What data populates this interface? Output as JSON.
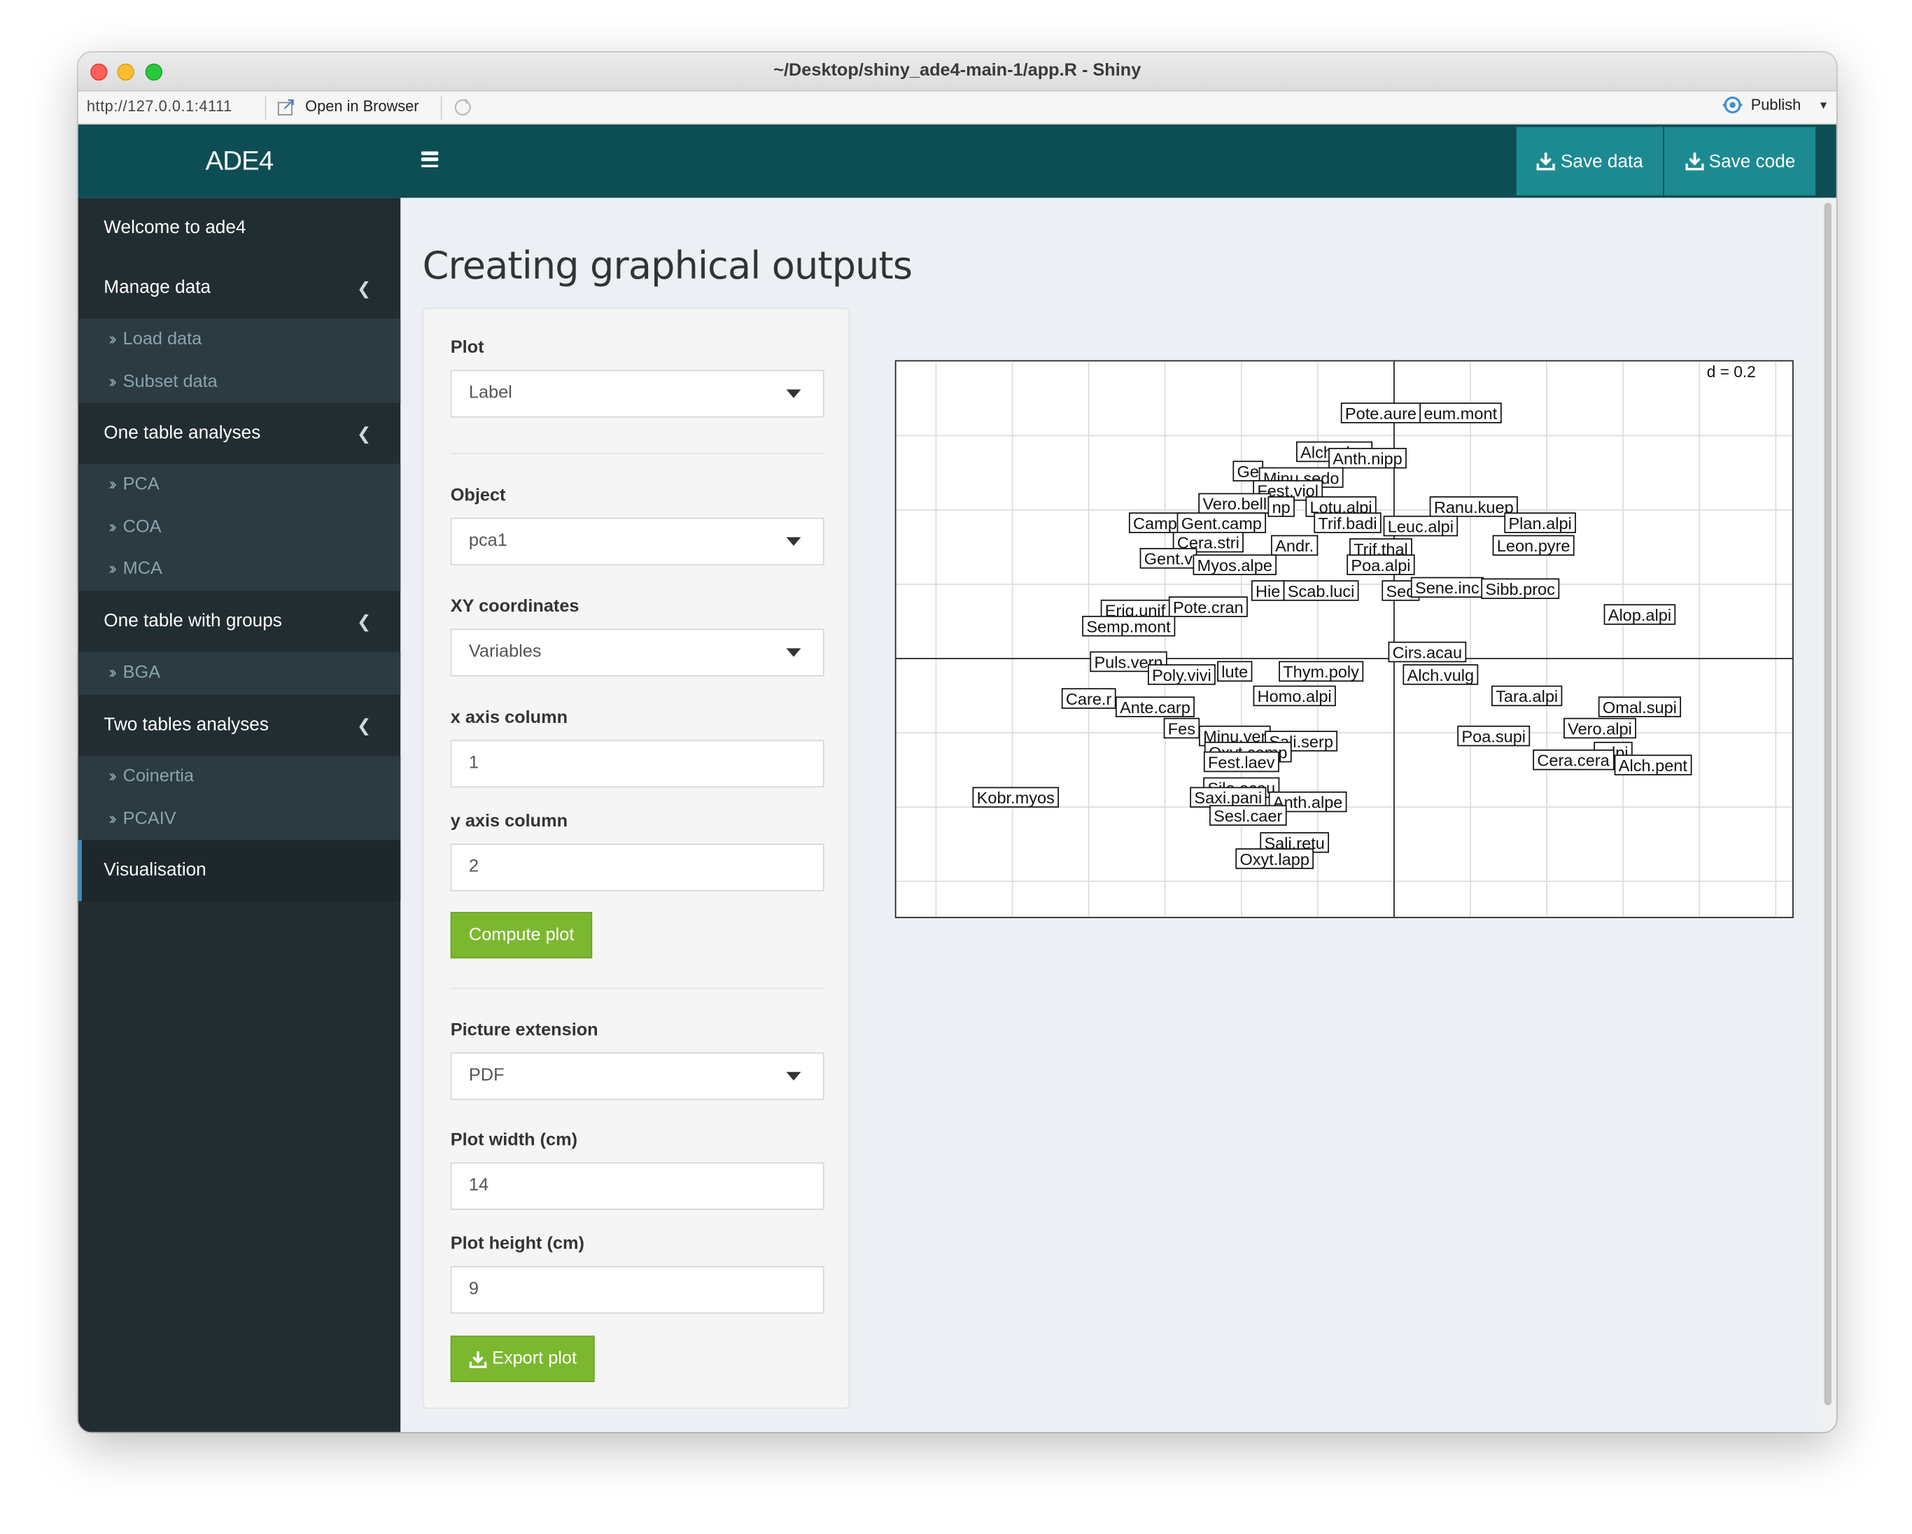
{
  "window": {
    "title": "~/Desktop/shiny_ade4-main-1/app.R - Shiny"
  },
  "addressbar": {
    "url": "http://127.0.0.1:4111",
    "open_in_browser": "Open in Browser",
    "publish": "Publish"
  },
  "navbar": {
    "logo": "ADE4",
    "save_data": "Save data",
    "save_code": "Save code"
  },
  "sidebar": {
    "welcome": "Welcome to ade4",
    "manage_data": "Manage data",
    "load_data": "Load data",
    "subset_data": "Subset data",
    "one_table": "One table analyses",
    "pca": "PCA",
    "coa": "COA",
    "mca": "MCA",
    "one_table_groups": "One table with groups",
    "bga": "BGA",
    "two_tables": "Two tables analyses",
    "coinertia": "Coinertia",
    "pcaiv": "PCAIV",
    "visualisation": "Visualisation"
  },
  "main": {
    "title": "Creating graphical outputs"
  },
  "form": {
    "plot_label": "Plot",
    "plot_value": "Label",
    "object_label": "Object",
    "object_value": "pca1",
    "xy_label": "XY coordinates",
    "xy_value": "Variables",
    "xaxis_label": "x axis column",
    "xaxis_value": "1",
    "yaxis_label": "y axis column",
    "yaxis_value": "2",
    "compute_button": "Compute plot",
    "ext_label": "Picture extension",
    "ext_value": "PDF",
    "width_label": "Plot width (cm)",
    "width_value": "14",
    "height_label": "Plot height (cm)",
    "height_value": "9",
    "export_button": "Export plot"
  },
  "chart_data": {
    "type": "scatter",
    "title": "",
    "scale_label": "d = 0.2",
    "grid": true,
    "xlim": [
      -0.75,
      0.6
    ],
    "ylim": [
      -0.4,
      0.46
    ],
    "labels": [
      {
        "name": "Pote.aure",
        "x": -0.02,
        "y": 0.38
      },
      {
        "name": "eum.mont",
        "x": 0.1,
        "y": 0.38
      },
      {
        "name": "Alch.glau",
        "x": -0.09,
        "y": 0.32
      },
      {
        "name": "Anth.nipp",
        "x": -0.04,
        "y": 0.31
      },
      {
        "name": "Ge",
        "x": -0.22,
        "y": 0.29
      },
      {
        "name": "Minu.sedo",
        "x": -0.14,
        "y": 0.28
      },
      {
        "name": "Fest.viol",
        "x": -0.16,
        "y": 0.26
      },
      {
        "name": "Vero.bell",
        "x": -0.24,
        "y": 0.24
      },
      {
        "name": "np",
        "x": -0.17,
        "y": 0.235
      },
      {
        "name": "Lotu.alpi",
        "x": -0.08,
        "y": 0.235
      },
      {
        "name": "Ranu.kuep",
        "x": 0.12,
        "y": 0.235
      },
      {
        "name": "Camp",
        "x": -0.36,
        "y": 0.21
      },
      {
        "name": "Gent.camp",
        "x": -0.26,
        "y": 0.21
      },
      {
        "name": "Trif.badi",
        "x": -0.07,
        "y": 0.21
      },
      {
        "name": "Leuc.alpi",
        "x": 0.04,
        "y": 0.205
      },
      {
        "name": "Plan.alpi",
        "x": 0.22,
        "y": 0.21
      },
      {
        "name": "Cera.stri",
        "x": -0.28,
        "y": 0.18
      },
      {
        "name": "Andr.",
        "x": -0.15,
        "y": 0.175
      },
      {
        "name": "Trif.thal",
        "x": -0.02,
        "y": 0.17
      },
      {
        "name": "Leon.pyre",
        "x": 0.21,
        "y": 0.175
      },
      {
        "name": "Gent.v",
        "x": -0.34,
        "y": 0.155
      },
      {
        "name": "Myos.alpe",
        "x": -0.24,
        "y": 0.145
      },
      {
        "name": "Poa.alpi",
        "x": -0.02,
        "y": 0.145
      },
      {
        "name": "Hie",
        "x": -0.19,
        "y": 0.105
      },
      {
        "name": "Scab.luci",
        "x": -0.11,
        "y": 0.105
      },
      {
        "name": "Sed",
        "x": 0.01,
        "y": 0.105
      },
      {
        "name": "Sene.inc",
        "x": 0.08,
        "y": 0.11
      },
      {
        "name": "Sibb.proc",
        "x": 0.19,
        "y": 0.108
      },
      {
        "name": "Erig.unif",
        "x": -0.39,
        "y": 0.075
      },
      {
        "name": "Pote.cran",
        "x": -0.28,
        "y": 0.08
      },
      {
        "name": "Alop.alpi",
        "x": 0.37,
        "y": 0.068
      },
      {
        "name": "Semp.mont",
        "x": -0.4,
        "y": 0.05
      },
      {
        "name": "Cirs.acau",
        "x": 0.05,
        "y": 0.01
      },
      {
        "name": "Puls.vern",
        "x": -0.4,
        "y": -0.005
      },
      {
        "name": "Thym.poly",
        "x": -0.11,
        "y": -0.02
      },
      {
        "name": "lute",
        "x": -0.24,
        "y": -0.02
      },
      {
        "name": "Poly.vivi",
        "x": -0.32,
        "y": -0.025
      },
      {
        "name": "Alch.vulg",
        "x": 0.07,
        "y": -0.025
      },
      {
        "name": "Homo.alpi",
        "x": -0.15,
        "y": -0.058
      },
      {
        "name": "Tara.alpi",
        "x": 0.2,
        "y": -0.058
      },
      {
        "name": "Care.r",
        "x": -0.46,
        "y": -0.062
      },
      {
        "name": "Ante.carp",
        "x": -0.36,
        "y": -0.075
      },
      {
        "name": "Omal.supi",
        "x": 0.37,
        "y": -0.075
      },
      {
        "name": "Fes",
        "x": -0.32,
        "y": -0.108
      },
      {
        "name": "Vero.alpi",
        "x": 0.31,
        "y": -0.108
      },
      {
        "name": "Minu.ver",
        "x": -0.24,
        "y": -0.12
      },
      {
        "name": "Sali.serp",
        "x": -0.14,
        "y": -0.128
      },
      {
        "name": "Poa.supi",
        "x": 0.15,
        "y": -0.12
      },
      {
        "name": "Oxyt.camp",
        "x": -0.22,
        "y": -0.145
      },
      {
        "name": ".alpi",
        "x": 0.33,
        "y": -0.145
      },
      {
        "name": "Fest.laev",
        "x": -0.23,
        "y": -0.16
      },
      {
        "name": "Cera.cera",
        "x": 0.27,
        "y": -0.157
      },
      {
        "name": "Alch.pent",
        "x": 0.39,
        "y": -0.165
      },
      {
        "name": "Sile.acau",
        "x": -0.23,
        "y": -0.2
      },
      {
        "name": "Kobr.myos",
        "x": -0.57,
        "y": -0.215
      },
      {
        "name": "Saxi.pani",
        "x": -0.25,
        "y": -0.215
      },
      {
        "name": "Anth.alpe",
        "x": -0.13,
        "y": -0.222
      },
      {
        "name": "Sesl.caer",
        "x": -0.22,
        "y": -0.243
      },
      {
        "name": "Sali.retu",
        "x": -0.15,
        "y": -0.285
      },
      {
        "name": "Oxyt.lapp",
        "x": -0.18,
        "y": -0.31
      }
    ]
  }
}
